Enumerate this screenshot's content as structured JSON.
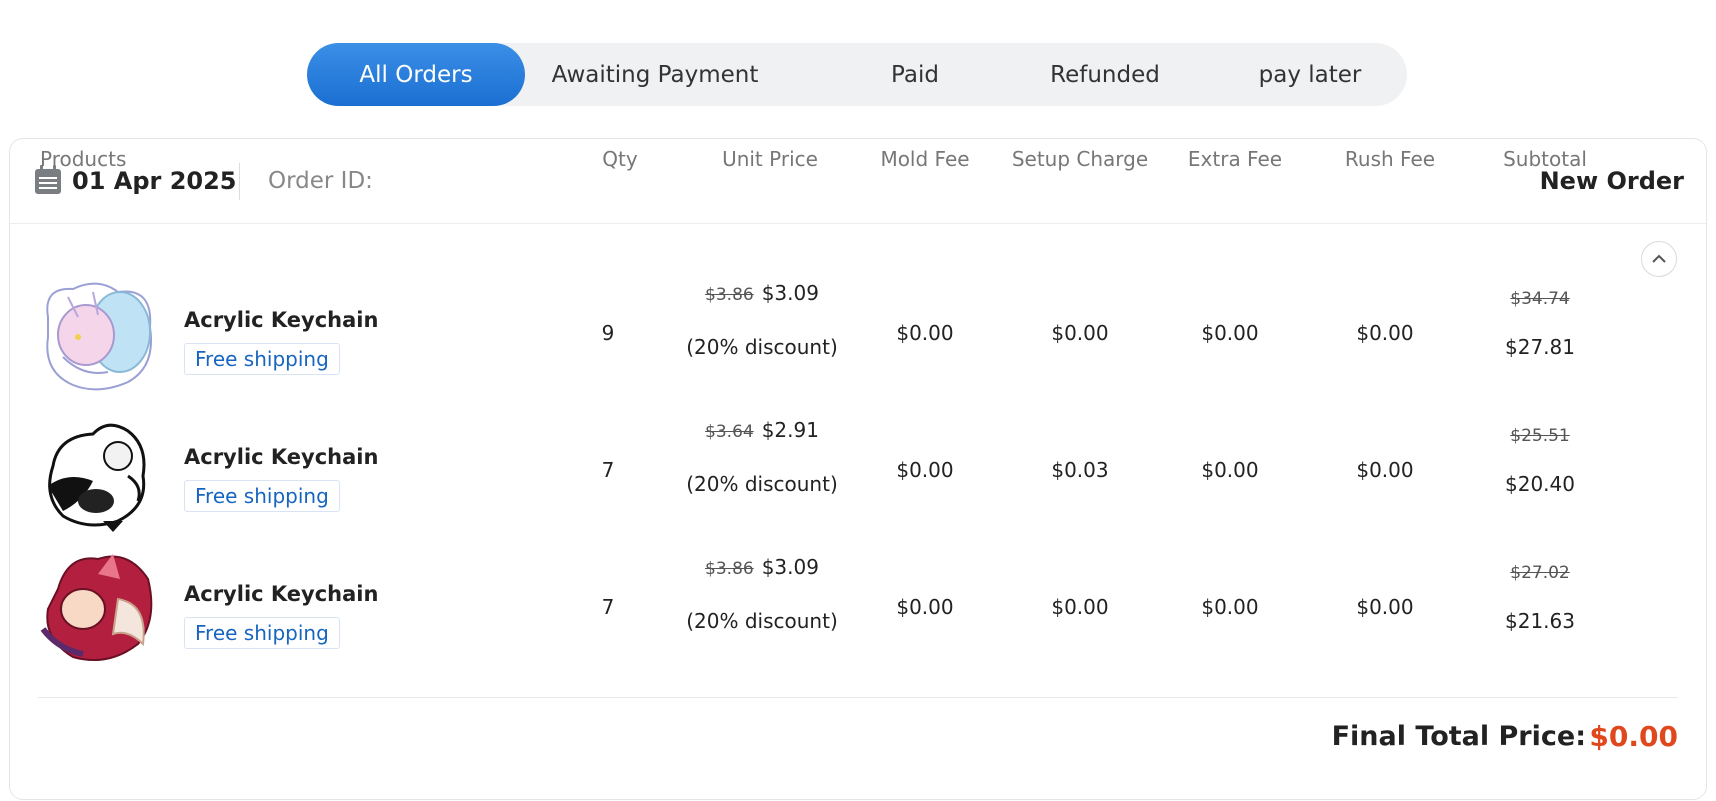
{
  "tabs": [
    {
      "label": "All Orders",
      "active": true
    },
    {
      "label": "Awaiting Payment",
      "active": false
    },
    {
      "label": "Paid",
      "active": false
    },
    {
      "label": "Refunded",
      "active": false
    },
    {
      "label": "pay later",
      "active": false
    }
  ],
  "order": {
    "date": "01 Apr 2025",
    "order_id_label": "Order ID:",
    "order_id_value": "",
    "status": "New Order",
    "columns": [
      "Products",
      "Qty",
      "Unit Price",
      "Mold Fee",
      "Setup Charge",
      "Extra Fee",
      "Rush Fee",
      "Subtotal"
    ],
    "items": [
      {
        "name": "Acrylic Keychain",
        "badge": "Free shipping",
        "qty": "9",
        "unit_price_original": "$3.86",
        "unit_price": "$3.09",
        "discount": "(20% discount)",
        "mold_fee": "$0.00",
        "setup_charge": "$0.00",
        "extra_fee": "$0.00",
        "rush_fee": "$0.00",
        "subtotal_original": "$34.74",
        "subtotal": "$27.81",
        "thumb_icon": "pastel-fox-character-icon"
      },
      {
        "name": "Acrylic Keychain",
        "badge": "Free shipping",
        "qty": "7",
        "unit_price_original": "$3.64",
        "unit_price": "$2.91",
        "discount": "(20% discount)",
        "mold_fee": "$0.00",
        "setup_charge": "$0.03",
        "extra_fee": "$0.00",
        "rush_fee": "$0.00",
        "subtotal_original": "$25.51",
        "subtotal": "$20.40",
        "thumb_icon": "monochrome-character-icon"
      },
      {
        "name": "Acrylic Keychain",
        "badge": "Free shipping",
        "qty": "7",
        "unit_price_original": "$3.86",
        "unit_price": "$3.09",
        "discount": "(20% discount)",
        "mold_fee": "$0.00",
        "setup_charge": "$0.00",
        "extra_fee": "$0.00",
        "rush_fee": "$0.00",
        "subtotal_original": "$27.02",
        "subtotal": "$21.63",
        "thumb_icon": "crimson-fox-character-icon"
      }
    ],
    "final_total_label": "Final Total Price:",
    "final_total_value": "$0.00"
  },
  "colors": {
    "accent": "#1b6fd2",
    "total_red": "#e1471c",
    "link_blue": "#1865c0"
  }
}
